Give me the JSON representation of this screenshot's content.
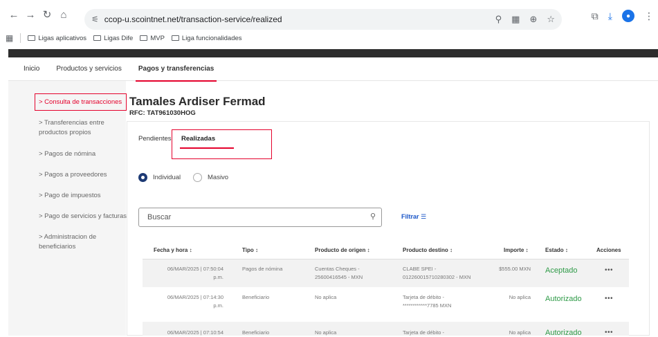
{
  "browser": {
    "url": "ccop-u.scointnet.net/transaction-service/realized",
    "bookmarks": [
      "Ligas aplicativos",
      "Ligas Dife",
      "MVP",
      "Liga funcionalidades"
    ]
  },
  "topnav": {
    "items": [
      "Inicio",
      "Productos y servicios",
      "Pagos y transferencias"
    ]
  },
  "sidebar": {
    "items": [
      "> Consulta de transacciones",
      "> Transferencias entre productos propios",
      "> Pagos de nómina",
      "> Pagos a proveedores",
      "> Pago de impuestos",
      "> Pago de servicios y facturas",
      "> Administracion de beneficiarios"
    ]
  },
  "header": {
    "company": "Tamales Ardiser Fermad",
    "rfc": "RFC: TAT961030HOG"
  },
  "tabs": {
    "pending": "Pendientes",
    "realized": "Realizadas"
  },
  "radios": {
    "individual": "Individual",
    "masivo": "Masivo"
  },
  "search": {
    "placeholder": "Buscar"
  },
  "filter": {
    "label": "Filtrar ☰"
  },
  "table": {
    "headers": [
      "Fecha y hora ↕",
      "Tipo ↕",
      "Producto de origen ↕",
      "Producto destino ↕",
      "Importe ↕",
      "Estado ↕",
      "Acciones"
    ],
    "rows": [
      {
        "fecha": "06/MAR/2025 | 07:50:04 p.m.",
        "tipo": "Pagos de nómina",
        "origen": "Cuentas Cheques - 25600416545 - MXN",
        "destino": "CLABE SPEI - 012260015710280302 - MXN",
        "importe": "$555.00 MXN",
        "estado": "Aceptado"
      },
      {
        "fecha": "06/MAR/2025 | 07:14:30 p.m.",
        "tipo": "Beneficiario",
        "origen": "No aplica",
        "destino": "Tarjeta de débito - ************7785 MXN",
        "importe": "No aplica",
        "estado": "Autorizado"
      },
      {
        "fecha": "06/MAR/2025 | 07:10:54",
        "tipo": "Beneficiario",
        "origen": "No aplica",
        "destino": "Tarjeta de débito -",
        "importe": "No aplica",
        "estado": "Autorizado"
      }
    ],
    "actions_label": "•••"
  }
}
